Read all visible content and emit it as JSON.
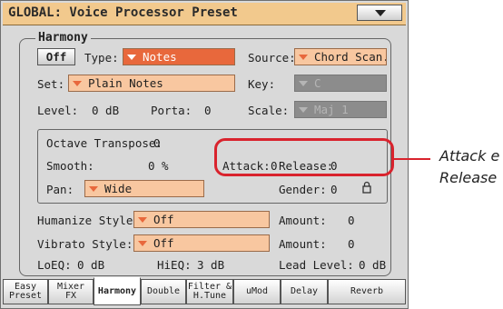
{
  "window": {
    "title": "GLOBAL: Voice Processor Preset"
  },
  "harmony": {
    "group_title": "Harmony",
    "off_button": "Off",
    "type_label": "Type:",
    "type_value": "Notes",
    "source_label": "Source:",
    "source_value": "Chord Scan.",
    "set_label": "Set:",
    "set_value": "Plain Notes",
    "key_label": "Key:",
    "key_value": "C",
    "level_label": "Level:",
    "level_value": "0 dB",
    "porta_label": "Porta:",
    "porta_value": "0",
    "scale_label": "Scale:",
    "scale_value": "Maj 1"
  },
  "inner": {
    "octave_label": "Octave Transpose:",
    "octave_value": "0",
    "smooth_label": "Smooth:",
    "smooth_value": "0 %",
    "attack_label": "Attack:",
    "attack_value": "0",
    "release_label": "Release:",
    "release_value": "0",
    "pan_label": "Pan:",
    "pan_value": "Wide",
    "gender_label": "Gender:",
    "gender_value": "0"
  },
  "lower": {
    "humanize_label": "Humanize Style:",
    "humanize_value": "Off",
    "humanize_amount_label": "Amount:",
    "humanize_amount_value": "0",
    "vibrato_label": "Vibrato Style:",
    "vibrato_value": "Off",
    "vibrato_amount_label": "Amount:",
    "vibrato_amount_value": "0",
    "loeq_label": "LoEQ:",
    "loeq_value": "0 dB",
    "hieq_label": "HiEQ:",
    "hieq_value": "3 dB",
    "lead_label": "Lead Level:",
    "lead_value": "0 dB"
  },
  "tabs": [
    {
      "line1": "Easy",
      "line2": "Preset"
    },
    {
      "line1": "Mixer",
      "line2": "FX"
    },
    {
      "line1": "Harmony",
      "line2": ""
    },
    {
      "line1": "Double",
      "line2": ""
    },
    {
      "line1": "Filter &",
      "line2": "H.Tune"
    },
    {
      "line1": "uMod",
      "line2": ""
    },
    {
      "line1": "Delay",
      "line2": ""
    },
    {
      "line1": "Reverb",
      "line2": ""
    }
  ],
  "annotation": {
    "line1": "Attack e",
    "line2": "Release"
  },
  "icons": {
    "menu": "chevron-down-icon",
    "gender_lock": "lock-icon"
  },
  "colors": {
    "title_bar": "#f2c98d",
    "dropdown": "#f8c7a0",
    "selected_dropdown": "#e8683c",
    "callout": "#d9232d"
  }
}
